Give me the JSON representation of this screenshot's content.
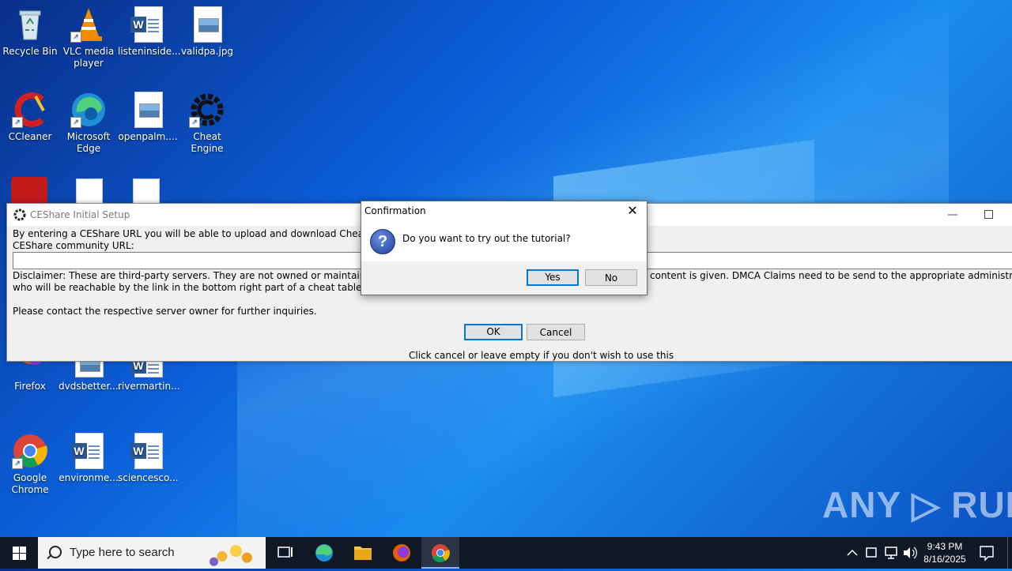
{
  "desktop": {
    "icons": [
      {
        "label": "Recycle Bin"
      },
      {
        "label": "VLC media player"
      },
      {
        "label": "listeninside..."
      },
      {
        "label": "validpa.jpg"
      },
      {
        "label": "CCleaner"
      },
      {
        "label": "Microsoft Edge"
      },
      {
        "label": "openpalm...."
      },
      {
        "label": "Cheat Engine"
      },
      {
        "label": "Firefox"
      },
      {
        "label": "dvdsbetter...."
      },
      {
        "label": "rivermartin..."
      },
      {
        "label": "Google Chrome"
      },
      {
        "label": "environme..."
      },
      {
        "label": "sciencesco..."
      }
    ]
  },
  "ceshare_window": {
    "title": "CEShare Initial Setup",
    "intro": "By entering a CEShare URL you will be able to upload and download Cheat Tables fro",
    "url_label": "CEShare community URL:",
    "url_value": "",
    "disclaimer_left": "Disclaimer: These are third-party servers. They are not owned or maintained by the C",
    "disclaimer_right": "content is given.  DMCA Claims need to be send to the appropriate administrator of the",
    "disclaimer_line2": "who will be reachable by the link in the bottom right part of a cheat table entry",
    "contact": "Please contact the respective server owner for further inquiries.",
    "ok_label": "OK",
    "cancel_label": "Cancel",
    "hint": "Click cancel or leave empty if you don't wish to use this"
  },
  "confirmation_dialog": {
    "title": "Confirmation",
    "message": "Do you want to try out the tutorial?",
    "yes_label": "Yes",
    "no_label": "No"
  },
  "watermark": "ANY ▷ RUN",
  "taskbar": {
    "search_placeholder": "Type here to search",
    "time": "9:43 PM",
    "date": "8/16/2025"
  }
}
